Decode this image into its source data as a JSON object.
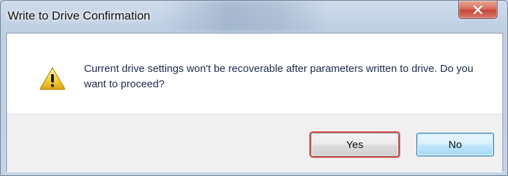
{
  "window": {
    "title": "Write to Drive Confirmation",
    "close_icon": "close-icon"
  },
  "message": {
    "icon": "warning-icon",
    "text": "Current drive settings won't be recoverable after parameters written to drive. Do you want to proceed?"
  },
  "buttons": {
    "yes_label": "Yes",
    "no_label": "No"
  },
  "colors": {
    "titlebar": "#c4d3e6",
    "close_button": "#c7483a",
    "message_area": "#ffffff",
    "button_bar": "#f0f0f0",
    "focus_outline": "#d9534f",
    "no_button_border": "#3c7fb1",
    "message_text": "#1a2a4a"
  }
}
